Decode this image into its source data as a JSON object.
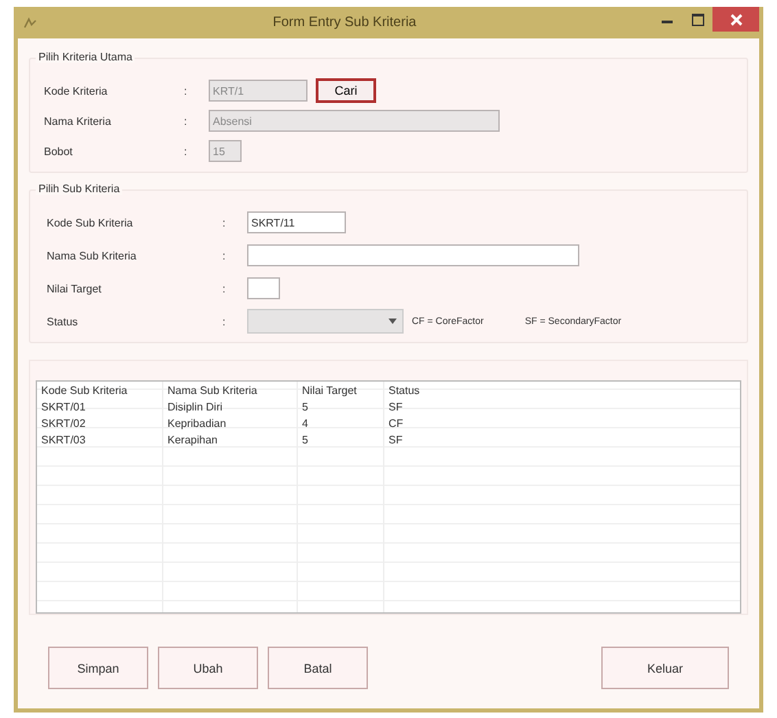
{
  "window": {
    "title": "Form Entry Sub Kriteria"
  },
  "group_main": {
    "title": "Pilih Kriteria Utama",
    "fields": [
      {
        "label": "Kode Kriteria",
        "separator": ":",
        "value": "KRT/1",
        "disabled": true,
        "button": {
          "label": "Cari",
          "focused": true
        }
      },
      {
        "label": "Nama Kriteria",
        "separator": ":",
        "value": "Absensi",
        "disabled": true
      },
      {
        "label": "Bobot",
        "separator": ":",
        "value": "15",
        "disabled": true
      }
    ]
  },
  "group_sub": {
    "title": "Pilih Sub Kriteria",
    "fields": [
      {
        "label": "Kode Sub Kriteria",
        "separator": ":",
        "value": "SKRT/11",
        "disabled": false,
        "kind": "text"
      },
      {
        "label": "Nama Sub Kriteria",
        "separator": ":",
        "disabled": false,
        "kind": "text"
      },
      {
        "label": "Nilai Target",
        "separator": ":",
        "disabled": false,
        "kind": "text"
      },
      {
        "label": "Status",
        "separator": ":",
        "disabled": true,
        "kind": "select",
        "notes": [
          "CF = CoreFactor",
          "SF = SecondaryFactor"
        ]
      }
    ]
  },
  "table": {
    "columns": [
      "Kode Sub Kriteria",
      "Nama Sub Kriteria",
      "Nilai Target",
      "Status"
    ],
    "rows": [
      [
        "SKRT/01",
        "Disiplin Diri",
        "5",
        "SF"
      ],
      [
        "SKRT/02",
        "Kepribadian",
        "4",
        "CF"
      ],
      [
        "SKRT/03",
        "Kerapihan",
        "5",
        "SF"
      ]
    ]
  },
  "buttons": [
    "Simpan",
    "Ubah",
    "Batal"
  ],
  "exit_button": "Keluar"
}
